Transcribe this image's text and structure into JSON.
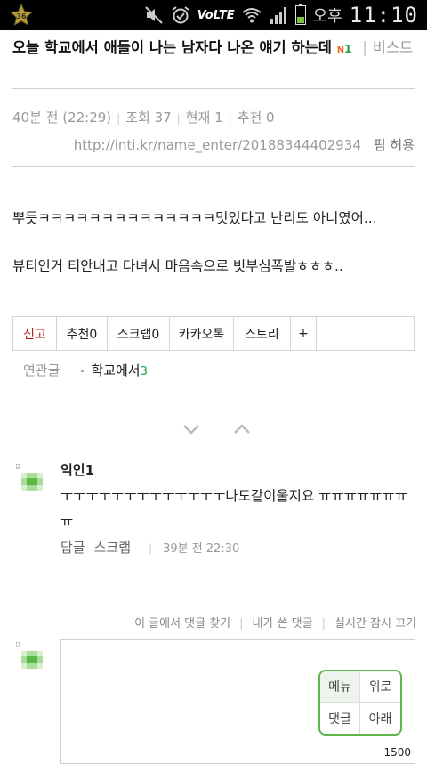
{
  "status_bar": {
    "ampm": "오후",
    "time": "11:10",
    "network": "VoLTE",
    "icons": [
      "app-badge-icon",
      "mute-icon",
      "alarm-icon",
      "volte-icon",
      "wifi-icon",
      "signal-icon",
      "battery-icon"
    ],
    "battery_fill_fraction": 0.35
  },
  "post": {
    "title": "오늘 학교에서 애들이 나는 남자다 나온 얘기 하는데",
    "new_mark": "N",
    "comment_count": "1",
    "board": "비스트",
    "meta": {
      "time": "40분 전 (22:29)",
      "views": "조회 37",
      "current": "현재 1",
      "recommend": "추천 0"
    },
    "url": "http://inti.kr/name_enter/20188344402934",
    "permission": "펌 허용",
    "body": [
      "뿌듯ㅋㅋㅋㅋㅋㅋㅋㅋㅋㅋㅋㅋㅋㅋ멋있다고 난리도 아니였어...",
      "뷰티인거 티안내고 다녀서 마음속으로 빗부심폭발ㅎㅎㅎ.."
    ]
  },
  "actions": {
    "report": "신고",
    "recommend": "추천0",
    "scrap": "스크랩0",
    "kakao": "카카오톡",
    "story": "스토리",
    "more": "+"
  },
  "related": {
    "label": "연관글",
    "keyword": "학교에서",
    "count": "3"
  },
  "comment": {
    "author": "익인1",
    "text": "ㅜㅜㅜㅜㅜㅜㅜㅜㅜㅜㅜㅜㅜ나도같이울지요 ㅠㅠㅠㅠㅠㅠㅠㅠ",
    "reply": "답글",
    "scrap": "스크랩",
    "time": "39분 전 22:30"
  },
  "comment_links": {
    "find": "이 글에서 댓글 찾기",
    "mine": "내가 쓴 댓글",
    "realtime": "실시간 잠시 끄기"
  },
  "nav_panel": {
    "menu": "메뉴",
    "top": "위로",
    "comments": "댓글",
    "bottom": "아래"
  },
  "char_limit": "1500",
  "colors": {
    "accent_green": "#5fb549",
    "count_green": "#19a33b",
    "report_red": "#b71a1a",
    "new_orange": "#ee6a1f"
  }
}
